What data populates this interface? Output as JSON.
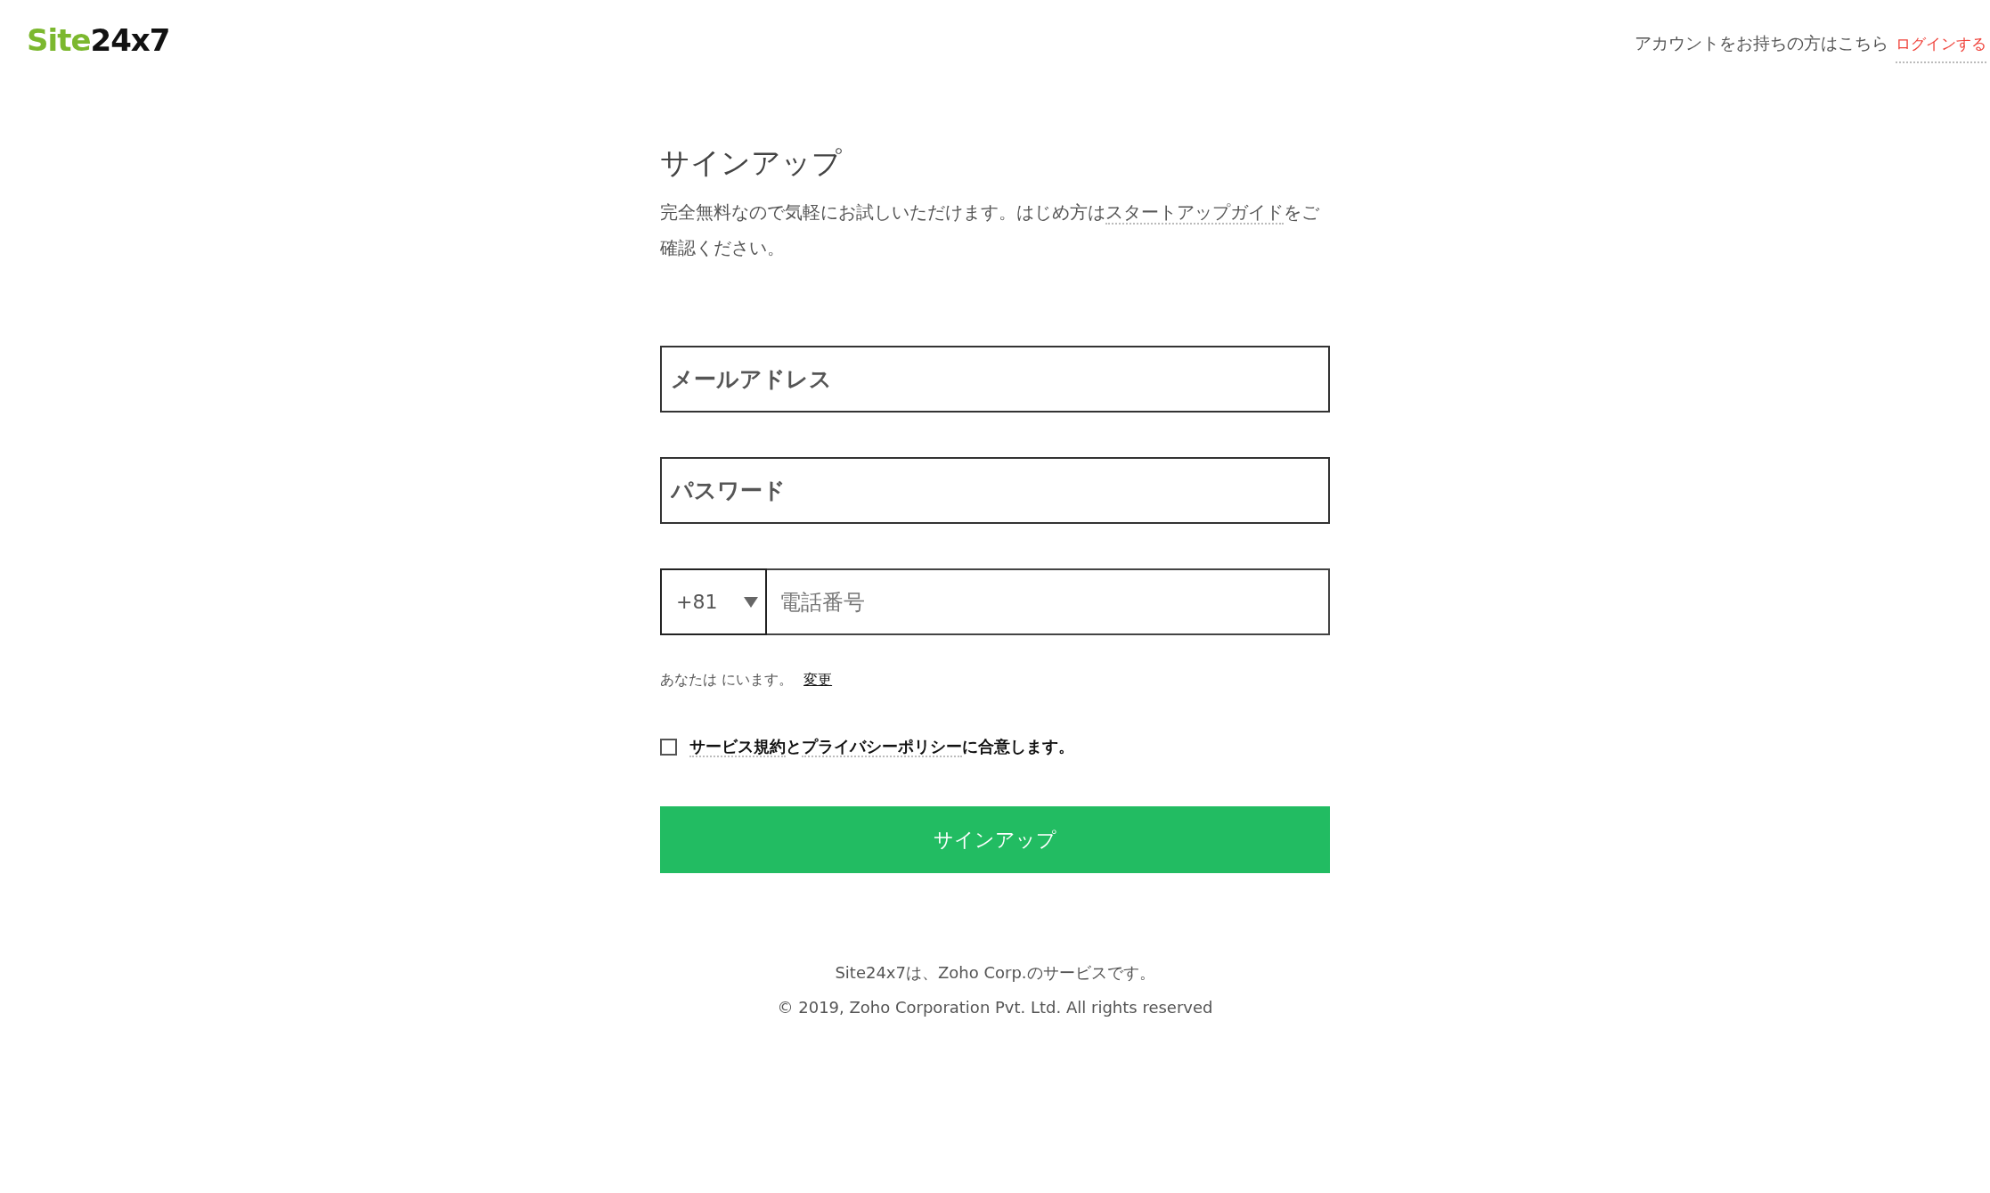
{
  "header": {
    "logo": {
      "part_1": "Site",
      "part_2": "24x7"
    },
    "account_prompt": "アカウントをお持ちの方はこちら",
    "login_link": "ログインする"
  },
  "form": {
    "title": "サインアップ",
    "intro": [
      {
        "kind": "text",
        "text": "完全無料なので気軽にお試しいただけます。はじめ方は"
      },
      {
        "kind": "link",
        "text": "スタートアップガイド"
      },
      {
        "kind": "text",
        "text": "をご確認ください。"
      }
    ],
    "email": {
      "placeholder": "メールアドレス"
    },
    "password": {
      "placeholder": "パスワード"
    },
    "phone": {
      "country_code": "+81",
      "placeholder": "電話番号"
    },
    "location": {
      "text": "あなたは にいます。",
      "change_link": "変更"
    },
    "terms": {
      "checked": false,
      "parts": [
        {
          "kind": "link",
          "text": "サービス規約"
        },
        {
          "kind": "text",
          "text": "と"
        },
        {
          "kind": "link",
          "text": "プライバシーポリシー"
        },
        {
          "kind": "text",
          "text": "に合意します。"
        }
      ]
    },
    "submit": "サインアップ"
  },
  "footer": [
    "Site24x7は、Zoho Corp.のサービスです。",
    "© 2019, Zoho Corporation Pvt. Ltd. All rights reserved"
  ]
}
